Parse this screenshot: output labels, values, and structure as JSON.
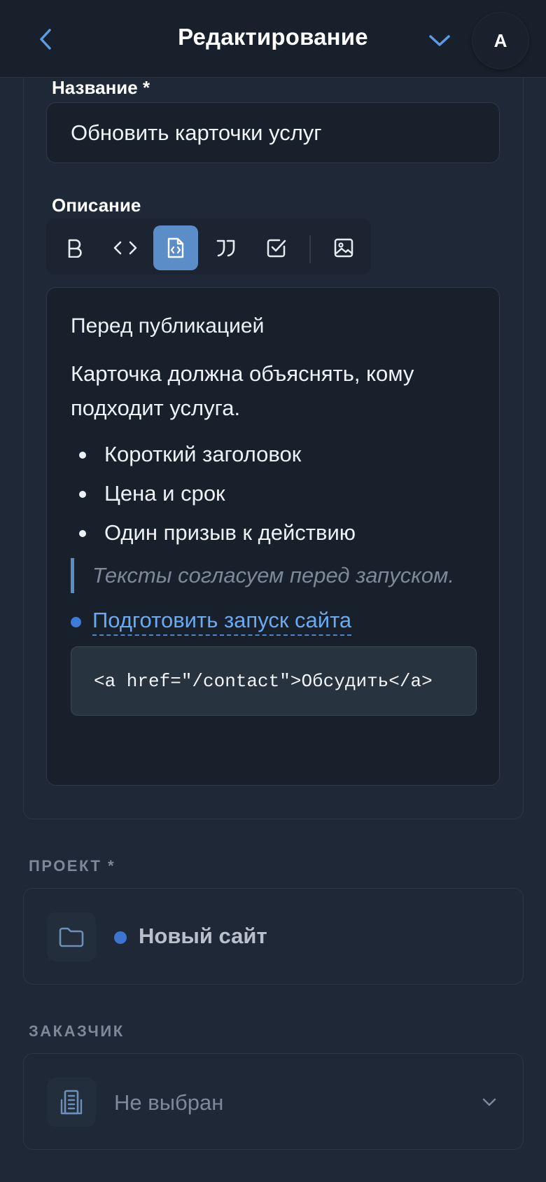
{
  "header": {
    "title": "Редактирование",
    "avatar_initial": "A",
    "back_icon": "chevron-left-icon",
    "expand_icon": "chevron-down-icon"
  },
  "form": {
    "title_label": "Название *",
    "title_value": "Обновить карточки услуг",
    "description_label": "Описание",
    "toolbar": [
      {
        "name": "bold",
        "icon": "bold-icon",
        "text": "B",
        "active": false
      },
      {
        "name": "inline-code",
        "icon": "code-icon",
        "text": "<>",
        "active": false
      },
      {
        "name": "code-block",
        "icon": "code-file-icon",
        "active": true
      },
      {
        "name": "quote",
        "icon": "quote-icon",
        "active": false
      },
      {
        "name": "checklist",
        "icon": "checkbox-icon",
        "active": false
      },
      {
        "name": "image",
        "icon": "image-icon",
        "active": false
      }
    ],
    "editor": {
      "heading": "Перед публикацией",
      "paragraph": "Карточка должна объяснять, кому подходит услуга.",
      "list": [
        "Короткий заголовок",
        "Цена и срок",
        "Один призыв к действию"
      ],
      "quote": "Тексты согласуем перед запуском.",
      "link": "Подготовить запуск сайта",
      "code": "<a href=\"/contact\">Обсудить</a>"
    }
  },
  "project": {
    "label": "ПРОЕКТ *",
    "value": "Новый сайт",
    "icon": "folder-icon",
    "dot_color": "#3d74cf"
  },
  "client": {
    "label": "ЗАКАЗЧИК",
    "value": "Не выбран",
    "icon": "building-icon"
  },
  "colors": {
    "accent": "#5b8dc8",
    "link": "#6aaaf0",
    "background": "#1e2836",
    "header": "#17202b"
  }
}
